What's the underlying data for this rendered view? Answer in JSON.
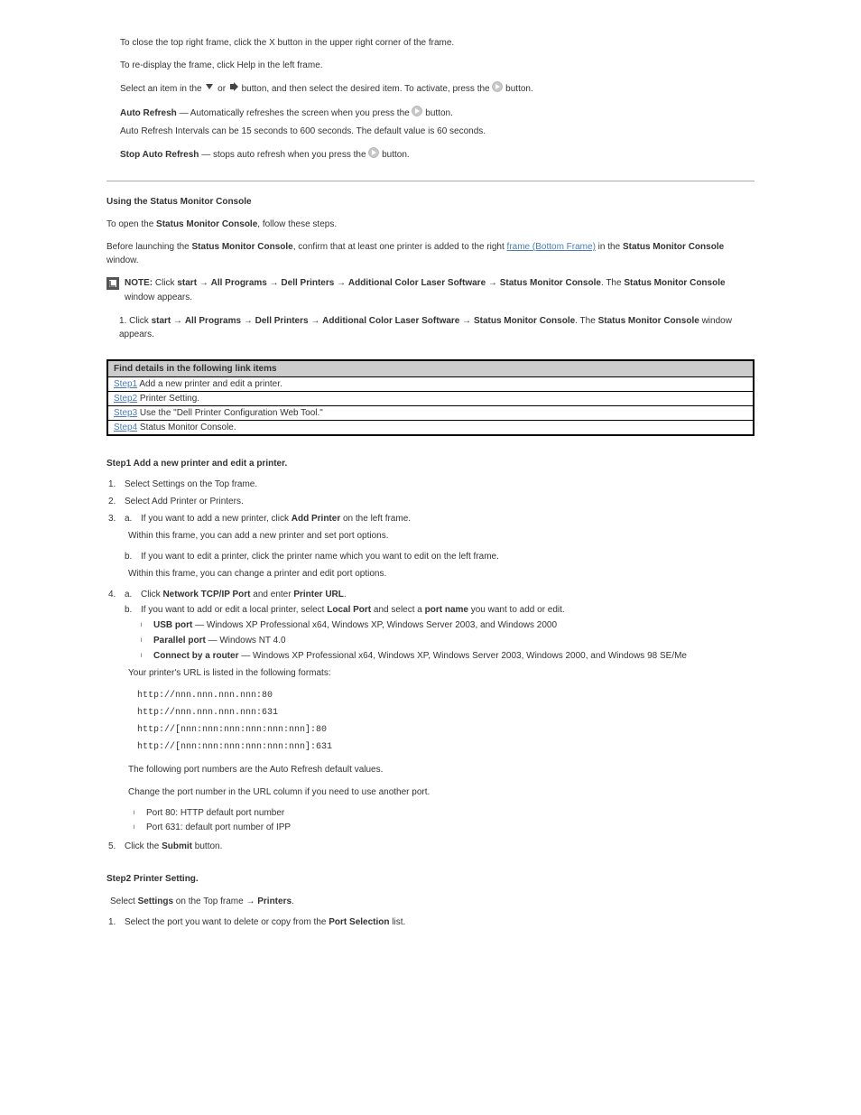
{
  "intro": {
    "line1": "To close the top right frame, click the X button in the upper right corner of the frame.",
    "line2": "To re-display the frame, click Help in the left frame.",
    "select_part1": "Select an item in the ",
    "select_plus": " or ",
    "select_part2": " button, and then select the desired item. To activate, press the ",
    "select_part3": " button.",
    "auto_refresh_label": "Auto Refresh",
    "auto_refresh_desc": " — Automatically refreshes the screen when you press the ",
    "auto_refresh_desc2": " button.",
    "ar_intervals": "Auto Refresh Intervals can be 15 seconds to 600 seconds. The default value is 60 seconds.",
    "stop_label": "Stop Auto Refresh",
    "stop_desc": " — stops auto refresh when you press the ",
    "stop_desc2": " button."
  },
  "using": {
    "heading": "Using the Status Monitor Console",
    "para_part1": "To open the ",
    "para_bold1": "Status Monitor Console",
    "para_part2": ", follow these steps.",
    "note_prefix": "NOTE: ",
    "note_body": "Before launching the ",
    "note_body2": ", confirm that at least one printer is added to the right ",
    "note_body3": " in the ",
    "note_body4": " window.",
    "step1_num": "1.",
    "step1_part1": "Click ",
    "step1_start": "start",
    "step1_allp": "All Programs ",
    "step1_dell": " Dell Printers ",
    "step1_as": "Additional Color Laser Software ",
    "step1_sm": " Status Monitor Console",
    "step1_tail": ". The ",
    "step1_tail2": " window appears.",
    "step1_link": "frame (Bottom Frame)"
  },
  "links_table": {
    "header": "Find details in the following link items",
    "rows": [
      {
        "label": "Step1",
        "rest": " Add a new printer and edit a printer."
      },
      {
        "label": "Step2",
        "rest": " Printer Setting."
      },
      {
        "label": "Step3",
        "rest": " Use the \"Dell Printer Configuration Web Tool.\""
      },
      {
        "label": "Step4",
        "rest": " Status Monitor Console."
      }
    ]
  },
  "step1": {
    "title": "Step1 Add a new printer and edit a printer.",
    "l1_num": "1.",
    "l1": "Select Settings on the Top frame.",
    "l2_num": "2.",
    "l2": "Select Add Printer or Printers.",
    "l3_num": "3.",
    "l3a_let": "a.",
    "l3a_part1": "If you want to add a new printer, click ",
    "l3a_bold": "Add Printer",
    "l3a_part2": " on the left frame.",
    "l3_within": "Within this frame, you can add a new printer and set port options.",
    "l3b_let": "b.",
    "l3b": "If you want to edit a printer, click the printer name which you want to edit on the left frame.",
    "l3_within2": "Within this frame, you can change a printer and edit port options.",
    "l4_num": "4.",
    "l4a_let": "a.",
    "l4a_part1": "Click ",
    "l4a_bold": "Network TCP/IP Port",
    "l4a_part2": " and enter ",
    "l4a_bold2": "Printer URL",
    "l4a_part3": ".",
    "l4b_let": "b.",
    "l4b_part1": "If you want to add or edit a local printer, select ",
    "l4b_bold": "Local Port",
    "l4b_part2": " and select a ",
    "l4b_bold2": "port name",
    "l4b_part3": " you want to add or edit.",
    "ports": [
      {
        "bold": "USB port",
        "rest": " — Windows XP Professional x64, Windows XP, Windows Server 2003, and Windows 2000"
      },
      {
        "bold": "Parallel port",
        "rest": " — Windows NT 4.0"
      },
      {
        "bold": "Connect by a router",
        "rest": " — Windows XP Professional x64, Windows XP, Windows Server 2003, Windows 2000, and Windows 98 SE/Me"
      }
    ],
    "url_intro": "Your printer's URL is listed in the following formats:",
    "urls": [
      "http://nnn.nnn.nnn.nnn:80",
      "http://nnn.nnn.nnn.nnn:631",
      "http://[nnn:nnn:nnn:nnn:nnn:nnn]:80",
      "http://[nnn:nnn:nnn:nnn:nnn:nnn]:631"
    ],
    "default_ports_intro": "The following port numbers are the Auto Refresh default values.",
    "default_ports_note": "Change the port number in the URL column if you need to use another port.",
    "default_ports": [
      {
        "lead": "Port 80: ",
        "rest": "HTTP default port number"
      },
      {
        "lead": "Port 631: ",
        "rest": "default port number of IPP"
      }
    ],
    "l5_num": "5.",
    "l5_part1": "Click the ",
    "l5_bold": "Submit",
    "l5_part2": " button."
  },
  "step2": {
    "title": "Step2 Printer Setting.",
    "intro_part1": "Select ",
    "intro_bold": "Settings",
    "intro_part2": " on the Top frame ",
    "intro_bold2": "Printers",
    "intro_tail": ".",
    "l1_num": "1.",
    "l1_part1": "Select the port you want to delete or copy from the ",
    "l1_bold": "Port Selection",
    "l1_part2": " list."
  }
}
